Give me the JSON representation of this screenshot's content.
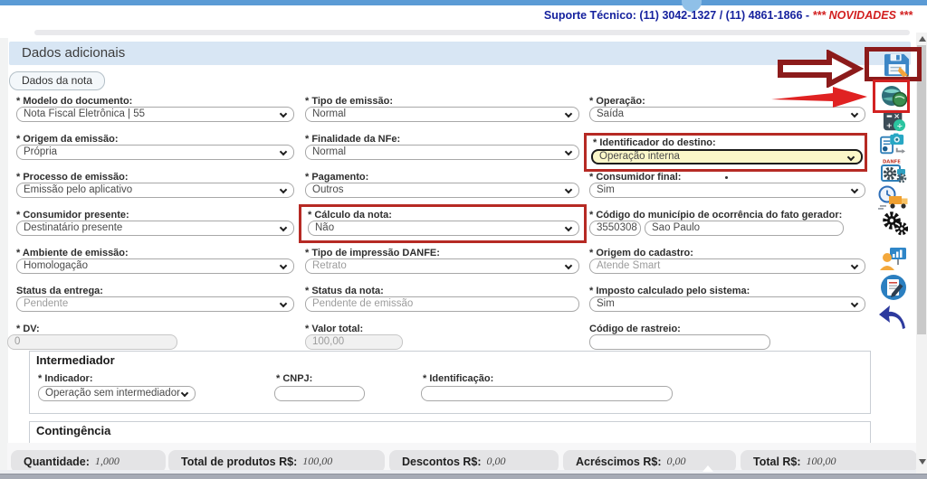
{
  "topbar": {
    "support_text": "Suporte Técnico: (11) 3042-1327 / (11) 4861-1866 - ",
    "news_text": "*** NOVIDADES ***"
  },
  "header": {
    "title": "Dados adicionais"
  },
  "tabs": {
    "dados_da_nota": "Dados da nota"
  },
  "form": {
    "fields": [
      {
        "label": "* Modelo do documento:",
        "value": "Nota Fiscal Eletrônica | 55"
      },
      {
        "label": "* Tipo de emissão:",
        "value": "Normal"
      },
      {
        "label": "* Operação:",
        "value": "Saída"
      },
      {
        "label": "* Origem da emissão:",
        "value": "Própria"
      },
      {
        "label": "* Finalidade da NFe:",
        "value": "Normal"
      },
      {
        "label": "* Identificador do destino:",
        "value": "Operação interna"
      },
      {
        "label": "* Processo de emissão:",
        "value": "Emissão pelo aplicativo"
      },
      {
        "label": "* Pagamento:",
        "value": "Outros"
      },
      {
        "label": "* Consumidor final:",
        "value": "Sim"
      },
      {
        "label": "* Consumidor presente:",
        "value": "Destinatário presente"
      },
      {
        "label": "* Cálculo da nota:",
        "value": "Não"
      },
      {
        "label": "* Código do município de ocorrência do fato gerador:",
        "code": "3550308",
        "city": "Sao Paulo"
      },
      {
        "label": "* Ambiente de emissão:",
        "value": "Homologação"
      },
      {
        "label": "* Tipo de impressão DANFE:",
        "value": "Retrato"
      },
      {
        "label": "* Origem do cadastro:",
        "value": "Atende Smart"
      },
      {
        "label": "Status da entrega:",
        "value": "Pendente"
      },
      {
        "label": "* Status da nota:",
        "value": "Pendente de emissão"
      },
      {
        "label": "* Imposto calculado pelo sistema:",
        "value": "Sim"
      },
      {
        "label": "* DV:",
        "value": "0"
      },
      {
        "label": "* Valor total:",
        "value": "100,00"
      },
      {
        "label": "Código de rastreio:",
        "value": ""
      }
    ]
  },
  "intermediador": {
    "title": "Intermediador",
    "indicador_label": "* Indicador:",
    "indicador_value": "Operação sem intermediador",
    "cnpj_label": "* CNPJ:",
    "cnpj_value": "",
    "identificacao_label": "* Identificação:",
    "identificacao_value": ""
  },
  "contingencia": {
    "title": "Contingência"
  },
  "totals": [
    {
      "label": "Quantidade:",
      "value": "1,000"
    },
    {
      "label": "Total de produtos R$:",
      "value": "100,00"
    },
    {
      "label": "Descontos R$:",
      "value": "0,00"
    },
    {
      "label": "Acréscimos R$:",
      "value": "0,00"
    },
    {
      "label": "Total R$:",
      "value": "100,00"
    }
  ],
  "sidebar": {
    "danfe_label": "DANFE",
    "icons": [
      "save",
      "transmit-globe",
      "calculator",
      "copy-photo",
      "danfe-settings",
      "schedule-delivery",
      "settings-gears",
      "client-report",
      "edit-note",
      "back-arrow"
    ]
  },
  "colors": {
    "accent_blue": "#5b9bd5",
    "header_bg": "#d8e6f4",
    "highlight_yellow": "#fbf7c9",
    "annotation_red": "#b62a24",
    "annotation_dark_red": "#8c1b1b",
    "support_blue": "#16229e",
    "news_red": "#d21f1f"
  }
}
